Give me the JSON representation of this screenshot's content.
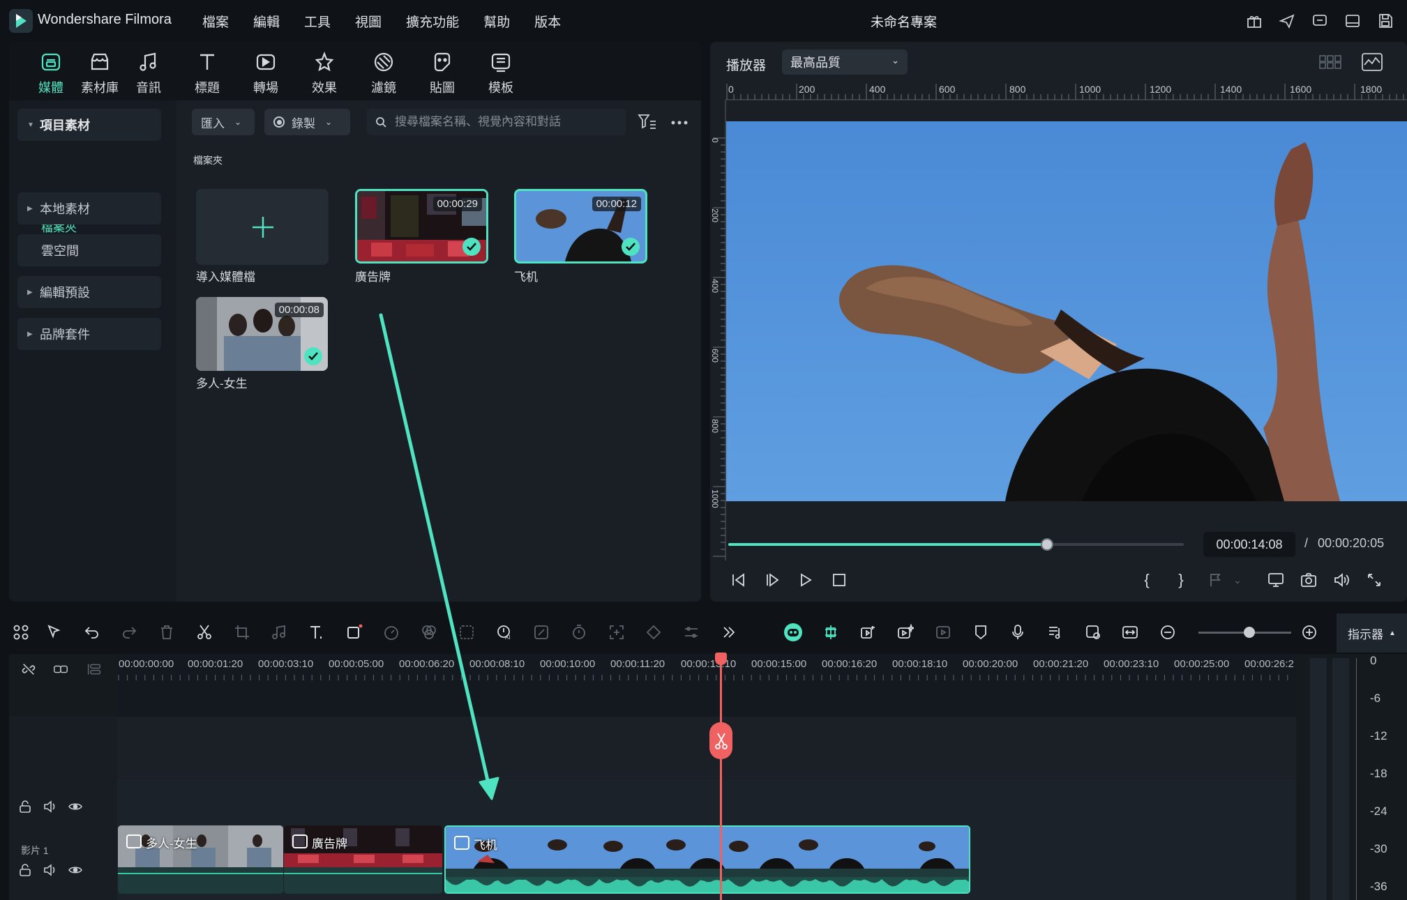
{
  "app": {
    "name": "Wondershare Filmora",
    "project_title": "未命名專案"
  },
  "menu": [
    "檔案",
    "編輯",
    "工具",
    "視圖",
    "擴充功能",
    "幫助",
    "版本"
  ],
  "media_tabs": [
    {
      "label": "媒體",
      "icon": "media-icon",
      "active": true
    },
    {
      "label": "素材庫",
      "icon": "store-icon"
    },
    {
      "label": "音訊",
      "icon": "music-icon"
    },
    {
      "label": "標題",
      "icon": "title-icon"
    },
    {
      "label": "轉場",
      "icon": "transition-icon"
    },
    {
      "label": "效果",
      "icon": "effects-icon"
    },
    {
      "label": "濾鏡",
      "icon": "filter-icon"
    },
    {
      "label": "貼圖",
      "icon": "sticker-icon"
    },
    {
      "label": "模板",
      "icon": "template-icon"
    }
  ],
  "sidebar": {
    "items": [
      {
        "label": "項目素材",
        "expanded": true
      },
      {
        "label": "本地素材"
      },
      {
        "label": "雲空間"
      },
      {
        "label": "編輯預設"
      },
      {
        "label": "品牌套件"
      }
    ],
    "folder": "檔案夾"
  },
  "media_toolbar": {
    "import_label": "匯入",
    "record_label": "錄製",
    "search_placeholder": "搜尋檔案名稱、視覺內容和對話"
  },
  "media_area": {
    "folder_heading": "檔案夾",
    "import_label": "導入媒體檔",
    "items": [
      {
        "name": "廣告牌",
        "duration": "00:00:29"
      },
      {
        "name": "飞机",
        "duration": "00:00:12"
      },
      {
        "name": "多人-女生",
        "duration": "00:00:08"
      }
    ]
  },
  "player": {
    "label": "播放器",
    "quality": "最高品質",
    "ruler_h": [
      "0",
      "200",
      "400",
      "600",
      "800",
      "1000",
      "1200",
      "1400",
      "1600",
      "1800"
    ],
    "ruler_v": [
      "0",
      "200",
      "400",
      "600",
      "800",
      "1000"
    ],
    "current_time": "00:00:14:08",
    "separator": "/",
    "total_time": "00:00:20:05",
    "progress": 0.7
  },
  "timeline": {
    "indicator_label": "指示器",
    "zoom_level": 0.55,
    "timecodes": [
      "00:00:00:00",
      "00:00:01:20",
      "00:00:03:10",
      "00:00:05:00",
      "00:00:06:20",
      "00:00:08:10",
      "00:00:10:00",
      "00:00:11:20",
      "00:00:13:10",
      "00:00:15:00",
      "00:00:16:20",
      "00:00:18:10",
      "00:00:20:00",
      "00:00:21:20",
      "00:00:23:10",
      "00:00:25:00",
      "00:00:26:2"
    ],
    "track_label": "影片 1",
    "clips": [
      {
        "name": "多人-女生"
      },
      {
        "name": "廣告牌"
      },
      {
        "name": "飞机"
      }
    ]
  },
  "meter": {
    "labels": [
      "0",
      "-6",
      "-12",
      "-18",
      "-24",
      "-30",
      "-36"
    ]
  },
  "colors": {
    "accent": "#4fe3c1",
    "playhead": "#f06262",
    "background": "#0f1216",
    "panel": "#1a1f25"
  }
}
